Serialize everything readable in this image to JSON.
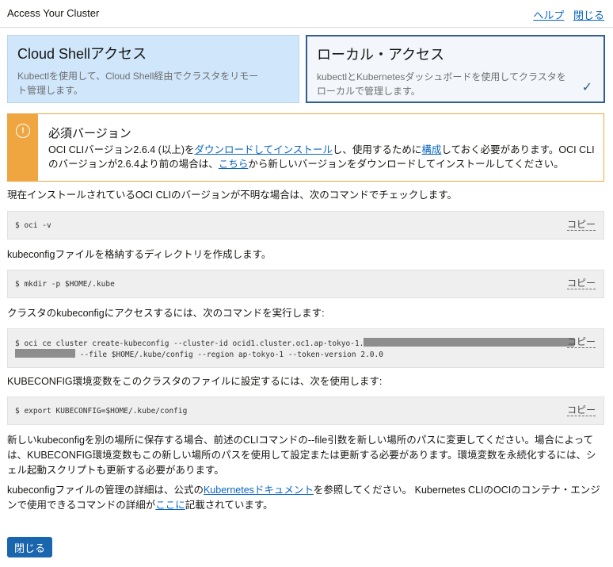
{
  "header": {
    "title": "Access Your Cluster",
    "help_link": "ヘルプ",
    "close_link": "閉じる"
  },
  "options": {
    "cloud_shell": {
      "title": "Cloud Shellアクセス",
      "desc_line1": "Kubectlを使用して、Cloud Shell経由でクラスタをリモー",
      "desc_line2": "ト管理します。"
    },
    "local": {
      "title": "ローカル・アクセス",
      "desc_line1": "kubectlとKubernetesダッシュボードを使用してクラスタを",
      "desc_line2": "ローカルで管理します。",
      "check": "✓"
    }
  },
  "warning": {
    "icon": "!",
    "title": "必須バージョン",
    "text1": "OCI CLIバージョン2.6.4 (以上)を",
    "link_download": "ダウンロードしてインストール",
    "text2": "し、使用するために",
    "link_configure": "構成",
    "text3": "しておく必要があります。OCI CLIのバージョンが2.6.4より前の場合は、",
    "link_here": "こちら",
    "text4": "から新しいバージョンをダウンロードしてインストールしてください。"
  },
  "steps": [
    {
      "text": "現在インストールされているOCI CLIのバージョンが不明な場合は、次のコマンドでチェックします。",
      "cmd": "$ oci -v"
    },
    {
      "text": "kubeconfigファイルを格納するディレクトリを作成します。",
      "cmd": "$ mkdir -p $HOME/.kube"
    },
    {
      "text": "クラスタのkubeconfigにアクセスするには、次のコマンドを実行します:",
      "cmd_line1": "$ oci ce cluster create-kubeconfig --cluster-id ocid1.cluster.oc1.ap-tokyo-1.",
      "cmd_line2": " --file $HOME/.kube/config --region ap-tokyo-1 --token-version 2.0.0"
    },
    {
      "text": "KUBECONFIG環境変数をこのクラスタのファイルに設定するには、次を使用します:",
      "cmd": "$ export KUBECONFIG=$HOME/.kube/config"
    }
  ],
  "copy_label": "コピー",
  "note1": "新しいkubeconfigを別の場所に保存する場合、前述のCLIコマンドの--file引数を新しい場所のパスに変更してください。場合によっては、KUBECONFIG環境変数もこの新しい場所のパスを使用して設定または更新する必要があります。環境変数を永続化するには、シェル起動スクリプトも更新する必要があります。",
  "note2": {
    "text1": "kubeconfigファイルの管理の詳細は、公式の",
    "link_docs": "Kubernetesドキュメント",
    "text2": "を参照してください。 Kubernetes CLIのOCIのコンテナ・エンジンで使用できるコマンドの詳細が",
    "link_here": "ここに",
    "text3": "記載されています。"
  },
  "close_button": "閉じる"
}
